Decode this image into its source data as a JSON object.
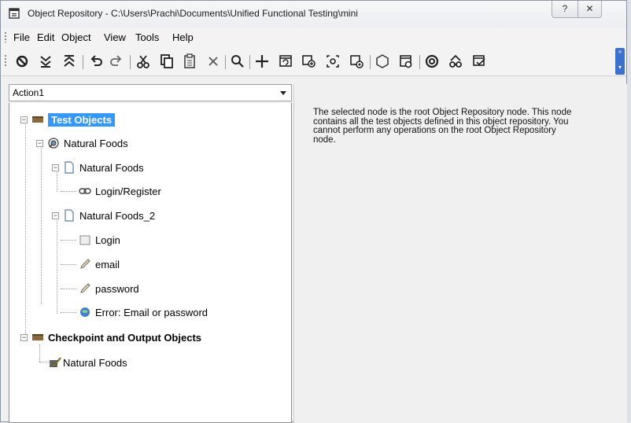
{
  "window": {
    "title": "Object Repository - C:\\Users\\Prachi\\Documents\\Unified Functional Testing\\mini",
    "help_btn": "?",
    "close_btn": "✕"
  },
  "menu": [
    {
      "label": "File"
    },
    {
      "label": "Edit"
    },
    {
      "label": "Object"
    },
    {
      "label": "View"
    },
    {
      "label": "Tools"
    },
    {
      "label": "Help"
    }
  ],
  "toolbar_icons": [
    "filter-icon",
    "expand-all-icon",
    "collapse-all-icon",
    "undo-icon",
    "redo-icon",
    "cut-icon",
    "copy-icon",
    "paste-icon",
    "delete-icon",
    "find-icon",
    "add-objects-icon",
    "update-from-app-icon",
    "add-to-local-icon",
    "highlight-icon",
    "locate-icon",
    "define-new-object-icon",
    "object-spy-icon",
    "associate-repositories-icon",
    "export-icon",
    "manage-icon"
  ],
  "action_combo": {
    "value": "Action1"
  },
  "tree": {
    "test_objects": "Test Objects",
    "browser": "Natural Foods",
    "page1": "Natural Foods",
    "link": "Login/Register",
    "page2": "Natural Foods_2",
    "button": "Login",
    "edit_email": "email",
    "edit_password": "password",
    "web_element": "Error: Email or password",
    "checkpoints": "Checkpoint and Output Objects",
    "checkpoint_item": "Natural Foods"
  },
  "info_text": "The selected node is the root Object Repository node. This node contains all the test objects defined in this object repository. You cannot perform any operations on the root Object Repository node."
}
